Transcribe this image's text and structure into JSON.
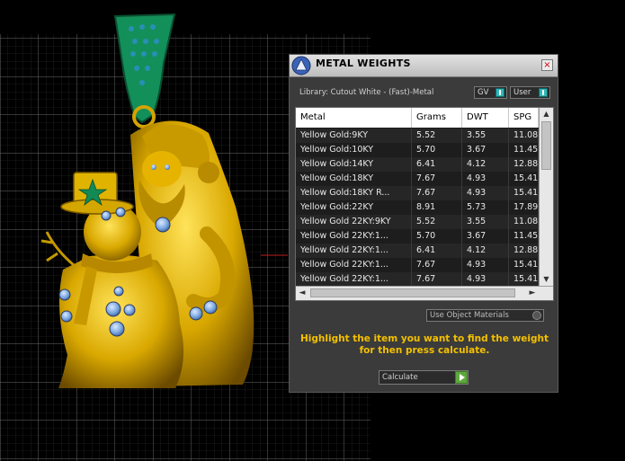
{
  "dialog": {
    "title": "METAL WEIGHTS",
    "close_glyph": "×",
    "library_label": "Library: Cutout White - (Fast)-Metal",
    "toggles": {
      "gv": "GV",
      "user": "User"
    },
    "use_object_materials": "Use Object Materials",
    "instruction_line1": "Highlight the item you want to find the weight",
    "instruction_line2": "for then press calculate.",
    "calculate_label": "Calculate"
  },
  "table": {
    "headers": [
      "Metal",
      "Grams",
      "DWT",
      "SPG"
    ],
    "rows": [
      [
        "Yellow Gold:9KY",
        "5.52",
        "3.55",
        "11.08"
      ],
      [
        "Yellow Gold:10KY",
        "5.70",
        "3.67",
        "11.45"
      ],
      [
        "Yellow Gold:14KY",
        "6.41",
        "4.12",
        "12.88"
      ],
      [
        "Yellow Gold:18KY",
        "7.67",
        "4.93",
        "15.41"
      ],
      [
        "Yellow Gold:18KY R...",
        "7.67",
        "4.93",
        "15.41"
      ],
      [
        "Yellow Gold:22KY",
        "8.91",
        "5.73",
        "17.89"
      ],
      [
        "Yellow Gold 22KY:9KY",
        "5.52",
        "3.55",
        "11.08"
      ],
      [
        "Yellow Gold 22KY:1...",
        "5.70",
        "3.67",
        "11.45"
      ],
      [
        "Yellow Gold 22KY:1...",
        "6.41",
        "4.12",
        "12.88"
      ],
      [
        "Yellow Gold 22KY:1...",
        "7.67",
        "4.93",
        "15.41"
      ],
      [
        "Yellow Gold 22KY:1...",
        "7.67",
        "4.93",
        "15.41"
      ]
    ]
  },
  "scrollbars": {
    "up": "▲",
    "down": "▼",
    "left": "◄",
    "right": "►"
  },
  "colors": {
    "gold": "#e2b300",
    "gold_dark": "#7a5a00",
    "bail_green": "#138f5a",
    "gem_blue": "#7aa7e0",
    "grid": "#555555",
    "accent_yellow": "#f3c000",
    "toggle_teal": "#32b6b6"
  },
  "icons": [
    "app-logo-icon",
    "close-icon",
    "toggle-knob-icon",
    "play-arrow-icon"
  ]
}
